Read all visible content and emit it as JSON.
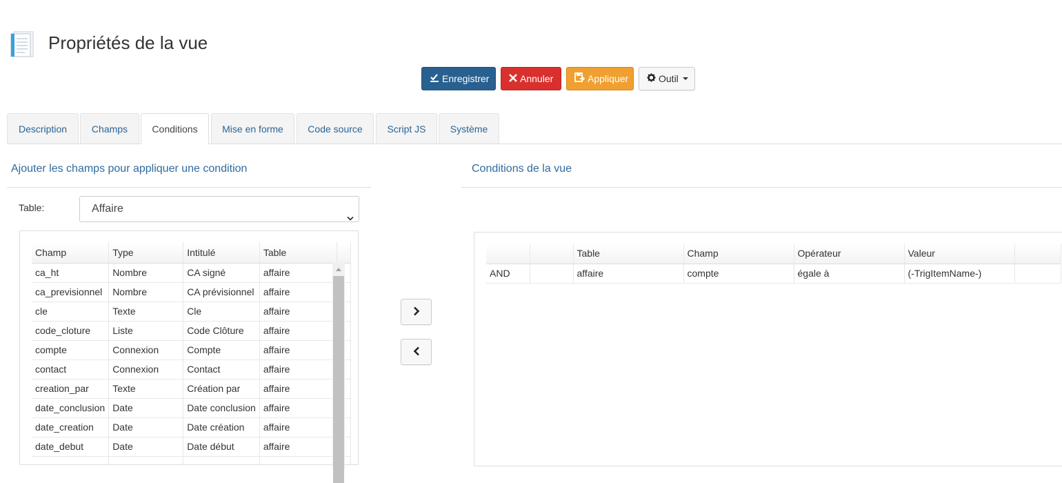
{
  "header": {
    "title": "Propriétés de la vue"
  },
  "toolbar": {
    "save_label": "Enregistrer",
    "cancel_label": "Annuler",
    "apply_label": "Appliquer",
    "tool_label": "Outil"
  },
  "tabs": [
    {
      "label": "Description"
    },
    {
      "label": "Champs"
    },
    {
      "label": "Conditions"
    },
    {
      "label": "Mise en forme"
    },
    {
      "label": "Code source"
    },
    {
      "label": "Script JS"
    },
    {
      "label": "Système"
    }
  ],
  "left": {
    "title": "Ajouter les champs pour appliquer une condition",
    "table_label": "Table:",
    "table_value": "Affaire",
    "columns": [
      "Champ",
      "Type",
      "Intitulé",
      "Table"
    ],
    "rows": [
      [
        "ca_ht",
        "Nombre",
        "CA signé",
        "affaire"
      ],
      [
        "ca_previsionnel",
        "Nombre",
        "CA prévisionnel",
        "affaire"
      ],
      [
        "cle",
        "Texte",
        "Cle",
        "affaire"
      ],
      [
        "code_cloture",
        "Liste",
        "Code Clôture",
        "affaire"
      ],
      [
        "compte",
        "Connexion",
        "Compte",
        "affaire"
      ],
      [
        "contact",
        "Connexion",
        "Contact",
        "affaire"
      ],
      [
        "creation_par",
        "Texte",
        "Création par",
        "affaire"
      ],
      [
        "date_conclusion",
        "Date",
        "Date conclusion",
        "affaire"
      ],
      [
        "date_creation",
        "Date",
        "Date création",
        "affaire"
      ],
      [
        "date_debut",
        "Date",
        "Date début",
        "affaire"
      ],
      [
        "",
        "",
        "",
        ""
      ]
    ]
  },
  "right": {
    "title": "Conditions de la vue",
    "columns": [
      "",
      "",
      "Table",
      "Champ",
      "Opérateur",
      "Valeur",
      ""
    ],
    "rows": [
      [
        "AND",
        "",
        "affaire",
        "compte",
        "égale à",
        "(-TrigItemName-)",
        ""
      ]
    ]
  },
  "colors": {
    "primary": "#286090",
    "danger": "#d9302d",
    "warning": "#f0a030",
    "link": "#2f6a9e"
  }
}
